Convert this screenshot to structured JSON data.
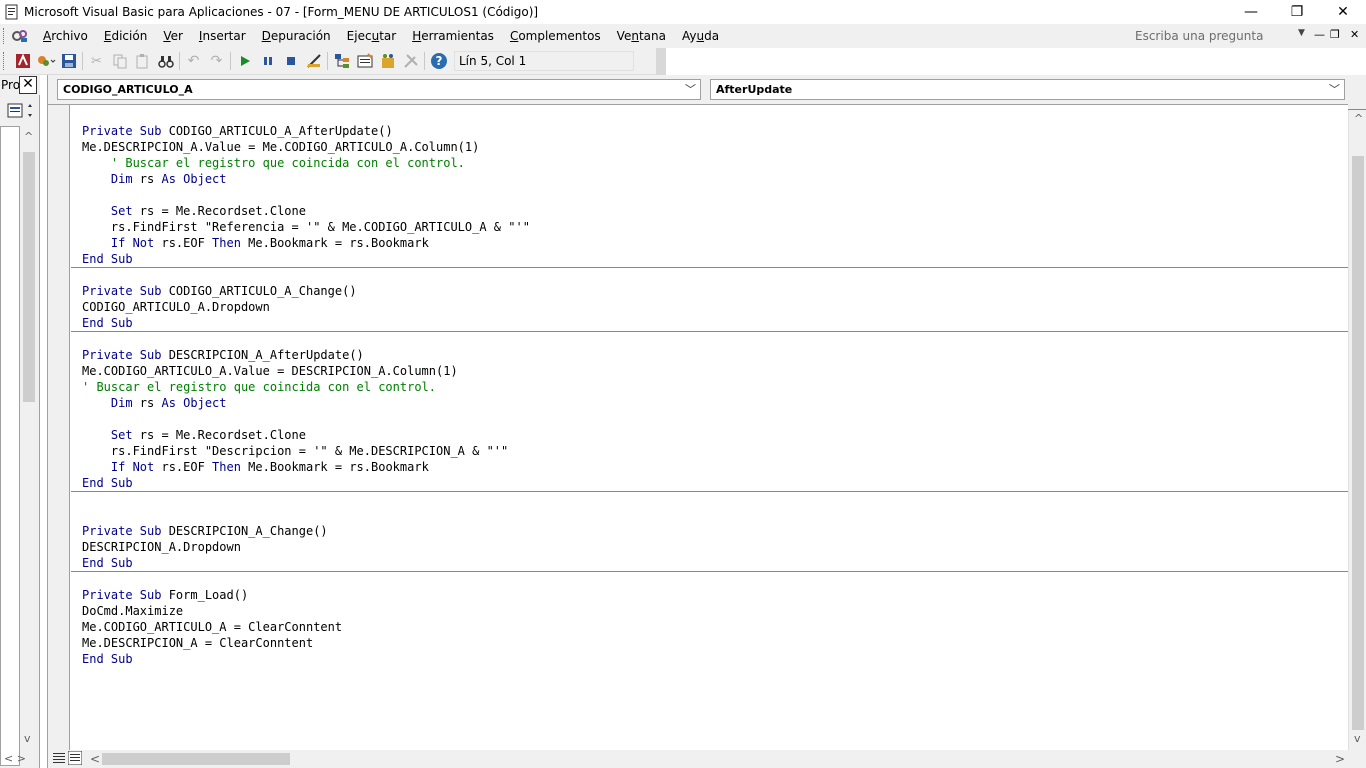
{
  "window": {
    "title": "Microsoft Visual Basic para Aplicaciones - 07 - [Form_MENU DE ARTICULOS1 (Código)]",
    "minimize": "—",
    "restore": "❐",
    "close": "✕"
  },
  "menu": {
    "items": [
      {
        "pre": "",
        "acc": "A",
        "post": "rchivo"
      },
      {
        "pre": "",
        "acc": "E",
        "post": "dición"
      },
      {
        "pre": "",
        "acc": "V",
        "post": "er"
      },
      {
        "pre": "",
        "acc": "I",
        "post": "nsertar"
      },
      {
        "pre": "",
        "acc": "D",
        "post": "epuración"
      },
      {
        "pre": "Ejec",
        "acc": "u",
        "post": "tar"
      },
      {
        "pre": "",
        "acc": "H",
        "post": "erramientas"
      },
      {
        "pre": "",
        "acc": "C",
        "post": "omplementos"
      },
      {
        "pre": "Ve",
        "acc": "n",
        "post": "tana"
      },
      {
        "pre": "Ay",
        "acc": "u",
        "post": "da"
      }
    ],
    "help_placeholder": "Escriba una pregunta"
  },
  "toolbar": {
    "position": "Lín 5, Col 1"
  },
  "project_panel": {
    "title": "Pro",
    "close": "✕"
  },
  "code_window": {
    "object_combo": "CODIGO_ARTICULO_A",
    "procedure_combo": "AfterUpdate"
  },
  "code_lines": [
    [
      {
        "k": "kw",
        "t": "Private Sub"
      },
      {
        "k": "",
        "t": " CODIGO_ARTICULO_A_AfterUpdate()"
      }
    ],
    [
      {
        "k": "",
        "t": "Me.DESCRIPCION_A.Value = Me.CODIGO_ARTICULO_A.Column(1)"
      }
    ],
    [
      {
        "k": "cm",
        "t": "    ' Buscar el registro que coincida con el control."
      }
    ],
    [
      {
        "k": "kw",
        "t": "    Dim"
      },
      {
        "k": "",
        "t": " rs "
      },
      {
        "k": "kw",
        "t": "As Object"
      }
    ],
    [
      {
        "k": "",
        "t": ""
      }
    ],
    [
      {
        "k": "kw",
        "t": "    Set"
      },
      {
        "k": "",
        "t": " rs = Me.Recordset.Clone"
      }
    ],
    [
      {
        "k": "",
        "t": "    rs.FindFirst \"Referencia = '\" & Me.CODIGO_ARTICULO_A & \"'\""
      }
    ],
    [
      {
        "k": "kw",
        "t": "    If Not"
      },
      {
        "k": "",
        "t": " rs.EOF "
      },
      {
        "k": "kw",
        "t": "Then"
      },
      {
        "k": "",
        "t": " Me.Bookmark = rs.Bookmark"
      }
    ],
    [
      {
        "k": "kw",
        "t": "End Sub"
      }
    ],
    [
      {
        "k": "",
        "t": ""
      }
    ],
    [
      {
        "k": "kw",
        "t": "Private Sub"
      },
      {
        "k": "",
        "t": " CODIGO_ARTICULO_A_Change()"
      }
    ],
    [
      {
        "k": "",
        "t": "CODIGO_ARTICULO_A.Dropdown"
      }
    ],
    [
      {
        "k": "kw",
        "t": "End Sub"
      }
    ],
    [
      {
        "k": "",
        "t": ""
      }
    ],
    [
      {
        "k": "kw",
        "t": "Private Sub"
      },
      {
        "k": "",
        "t": " DESCRIPCION_A_AfterUpdate()"
      }
    ],
    [
      {
        "k": "",
        "t": "Me.CODIGO_ARTICULO_A.Value = DESCRIPCION_A.Column(1)"
      }
    ],
    [
      {
        "k": "cm",
        "t": "' Buscar el registro que coincida con el control."
      }
    ],
    [
      {
        "k": "kw",
        "t": "    Dim"
      },
      {
        "k": "",
        "t": " rs "
      },
      {
        "k": "kw",
        "t": "As Object"
      }
    ],
    [
      {
        "k": "",
        "t": ""
      }
    ],
    [
      {
        "k": "kw",
        "t": "    Set"
      },
      {
        "k": "",
        "t": " rs = Me.Recordset.Clone"
      }
    ],
    [
      {
        "k": "",
        "t": "    rs.FindFirst \"Descripcion = '\" & Me.DESCRIPCION_A & \"'\""
      }
    ],
    [
      {
        "k": "kw",
        "t": "    If Not"
      },
      {
        "k": "",
        "t": " rs.EOF "
      },
      {
        "k": "kw",
        "t": "Then"
      },
      {
        "k": "",
        "t": " Me.Bookmark = rs.Bookmark"
      }
    ],
    [
      {
        "k": "kw",
        "t": "End Sub"
      }
    ],
    [
      {
        "k": "",
        "t": ""
      }
    ],
    [
      {
        "k": "",
        "t": ""
      }
    ],
    [
      {
        "k": "kw",
        "t": "Private Sub"
      },
      {
        "k": "",
        "t": " DESCRIPCION_A_Change()"
      }
    ],
    [
      {
        "k": "",
        "t": "DESCRIPCION_A.Dropdown"
      }
    ],
    [
      {
        "k": "kw",
        "t": "End Sub"
      }
    ],
    [
      {
        "k": "",
        "t": ""
      }
    ],
    [
      {
        "k": "kw",
        "t": "Private Sub"
      },
      {
        "k": "",
        "t": " Form_Load()"
      }
    ],
    [
      {
        "k": "",
        "t": "DoCmd.Maximize"
      }
    ],
    [
      {
        "k": "",
        "t": "Me.CODIGO_ARTICULO_A = ClearConntent"
      }
    ],
    [
      {
        "k": "",
        "t": "Me.DESCRIPCION_A = ClearConntent"
      }
    ],
    [
      {
        "k": "kw",
        "t": "End Sub"
      }
    ]
  ],
  "colors": {
    "keyword": "#00008b",
    "comment": "#008000",
    "chrome": "#f0f0f0"
  }
}
